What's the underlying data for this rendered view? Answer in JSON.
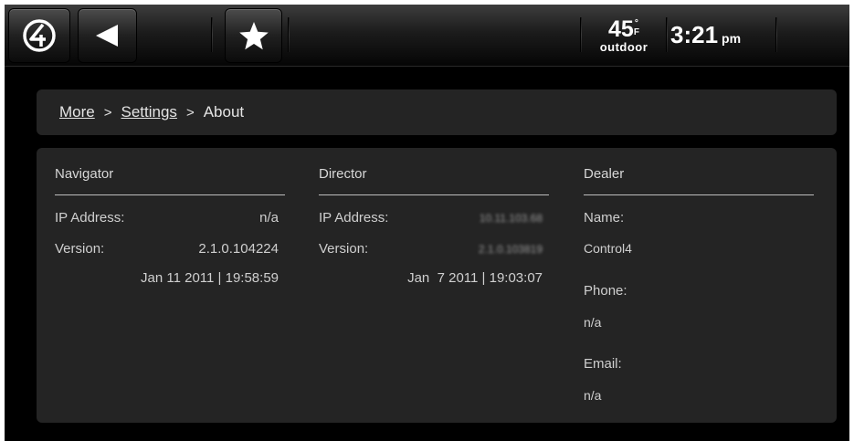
{
  "topbar": {
    "icons": {
      "home": "control4-logo-icon",
      "back": "back-arrow-icon",
      "favorites": "star-icon"
    },
    "weather": {
      "temperature": "45",
      "unit_degree": "°",
      "unit_letter": "F",
      "label": "outdoor"
    },
    "clock": {
      "time": "3:21",
      "ampm": "pm"
    }
  },
  "breadcrumb": {
    "items": [
      {
        "label": "More",
        "link": true
      },
      {
        "label": "Settings",
        "link": true
      },
      {
        "label": "About",
        "link": false
      }
    ],
    "separator": ">"
  },
  "navigator": {
    "title": "Navigator",
    "ip_label": "IP Address:",
    "ip_value": "n/a",
    "version_label": "Version:",
    "version_value": "2.1.0.104224",
    "build_date": "Jan 11 2011 | 19:58:59"
  },
  "director": {
    "title": "Director",
    "ip_label": "IP Address:",
    "ip_value": "10.11.103.68",
    "version_label": "Version:",
    "version_value": "2.1.0.103819",
    "build_date": "Jan  7 2011 | 19:03:07"
  },
  "dealer": {
    "title": "Dealer",
    "name_label": "Name:",
    "name_value": "Control4",
    "phone_label": "Phone:",
    "phone_value": "n/a",
    "email_label": "Email:",
    "email_value": "n/a"
  }
}
